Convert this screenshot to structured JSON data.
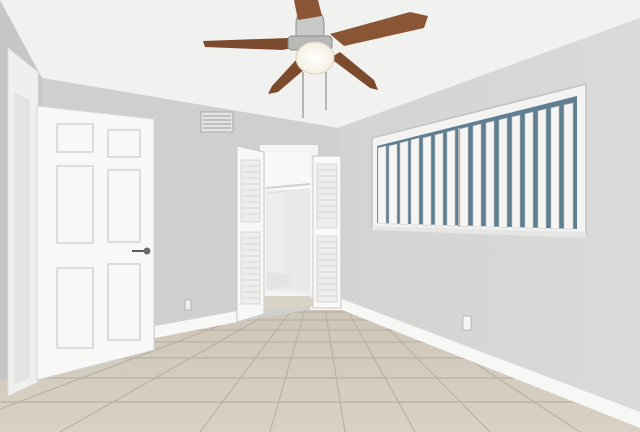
{
  "scene": {
    "kind": "photo",
    "subject": "empty-bedroom",
    "objects": [
      "ceiling-fan",
      "interior-door",
      "closet-doorway",
      "louvered-bifold-doors",
      "window-with-vertical-blinds",
      "hvac-vent",
      "tile-floor",
      "baseboard",
      "wall-outlet"
    ],
    "colors": {
      "ceiling": "#f1f1ef",
      "wall_left": "#c9c9c7",
      "wall_back": "#d0d0ce",
      "wall_right": "#d7d7d5",
      "floor": "#d4cdbf",
      "grout": "#b9b2a4",
      "trim": "#f7f7f5",
      "fan_blade": "#8a5534"
    }
  }
}
